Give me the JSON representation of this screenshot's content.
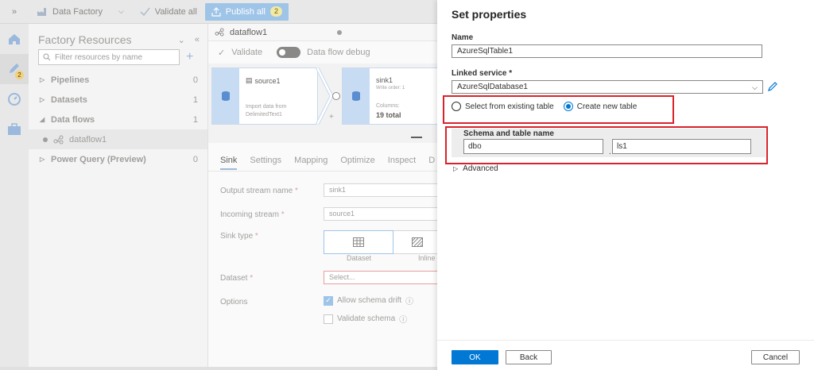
{
  "toolbar": {
    "factory_label": "Data Factory",
    "validate_all_label": "Validate all",
    "publish_all_label": "Publish all",
    "publish_badge": "2"
  },
  "rail": {
    "pencil_badge": "2"
  },
  "resources": {
    "title": "Factory Resources",
    "filter_placeholder": "Filter resources by name",
    "items": [
      {
        "label": "Pipelines",
        "count": "0"
      },
      {
        "label": "Datasets",
        "count": "1"
      },
      {
        "label": "Data flows",
        "count": "1"
      },
      {
        "label": "dataflow1",
        "count": ""
      },
      {
        "label": "Power Query (Preview)",
        "count": "0"
      }
    ]
  },
  "editor": {
    "tab_name": "dataflow1",
    "validate_label": "Validate",
    "debug_label": "Data flow debug",
    "source_node": {
      "title": "source1",
      "desc": "Import data from DelimitedText1"
    },
    "sink_node": {
      "title": "sink1",
      "sub": "Write order: 1",
      "columns_label": "Columns:",
      "total": "19 total"
    },
    "tabs": [
      "Sink",
      "Settings",
      "Mapping",
      "Optimize",
      "Inspect",
      "D"
    ],
    "fields": {
      "output_stream_label": "Output stream name",
      "output_stream_value": "sink1",
      "incoming_stream_label": "Incoming stream",
      "incoming_stream_value": "source1",
      "sink_type_label": "Sink type",
      "sink_type_dataset": "Dataset",
      "sink_type_inline": "Inline",
      "dataset_label": "Dataset",
      "dataset_placeholder": "Select...",
      "options_label": "Options",
      "allow_schema_drift": "Allow schema drift",
      "validate_schema": "Validate schema"
    }
  },
  "panel": {
    "title": "Set properties",
    "name_label": "Name",
    "name_value": "AzureSqlTable1",
    "linked_service_label": "Linked service *",
    "linked_service_value": "AzureSqlDatabase1",
    "radio_existing": "Select from existing table",
    "radio_new": "Create new table",
    "schema_label": "Schema and table name",
    "schema_value": "dbo",
    "dot": ".",
    "table_value": "ls1",
    "advanced_label": "Advanced",
    "ok_label": "OK",
    "back_label": "Back",
    "cancel_label": "Cancel"
  },
  "colors": {
    "primary": "#0078d4",
    "highlight": "#d9232c"
  }
}
